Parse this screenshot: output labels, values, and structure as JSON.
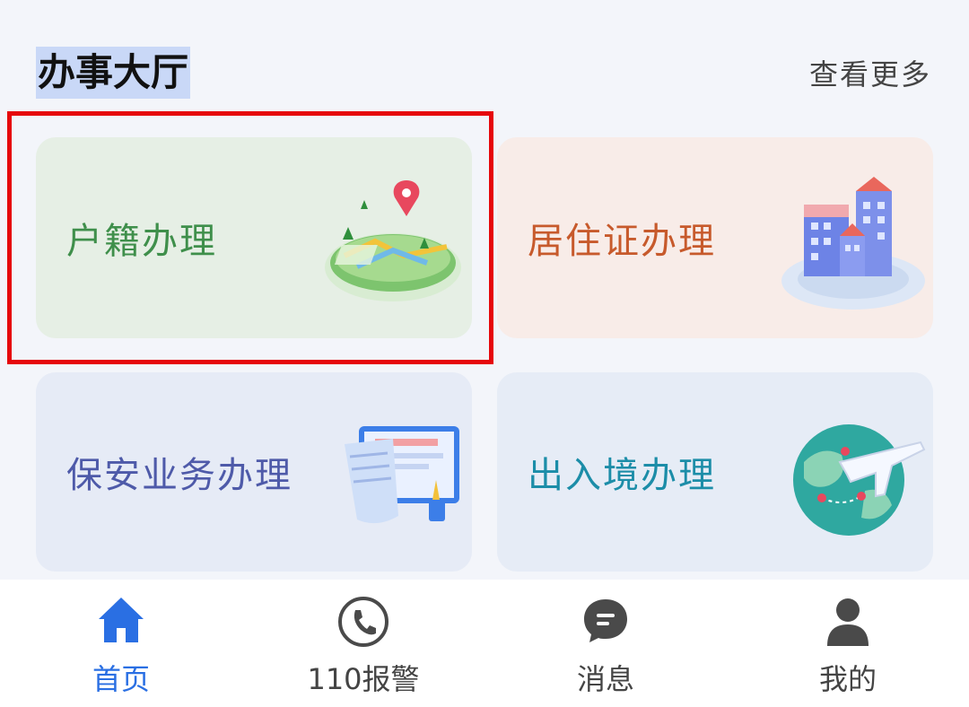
{
  "header": {
    "title": "办事大厅",
    "more_label": "查看更多"
  },
  "cards": [
    {
      "label": "户籍办理"
    },
    {
      "label": "居住证办理"
    },
    {
      "label": "保安业务办理"
    },
    {
      "label": "出入境办理"
    }
  ],
  "tabs": [
    {
      "label": "首页",
      "icon": "home-icon",
      "active": true
    },
    {
      "label": "110报警",
      "icon": "phone-icon",
      "active": false
    },
    {
      "label": "消息",
      "icon": "message-icon",
      "active": false
    },
    {
      "label": "我的",
      "icon": "user-icon",
      "active": false
    }
  ],
  "colors": {
    "accent": "#2a6fe3",
    "highlight": "#e6070b"
  }
}
